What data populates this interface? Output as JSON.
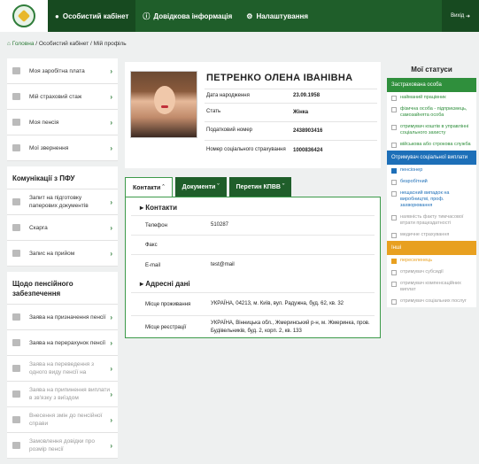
{
  "topbar": {
    "cabinet": "Особистий кабінет",
    "help": "Довідкова інформація",
    "settings": "Налаштування",
    "exit": "Вихід"
  },
  "breadcrumb": {
    "home": "Головна",
    "rest": " / Особистий кабінет / Мій профіль"
  },
  "sidebar": {
    "items": [
      "Моя заробітна плата",
      "Мій страховий стаж",
      "Моя пенсія",
      "Мої звернення"
    ],
    "comm_title": "Комунікації з ПФУ",
    "comm_items": [
      "Запит на підготовку паперових документів",
      "Скарга",
      "Запис на прийом"
    ],
    "pension_title": "Щодо пенсійного забезпечення",
    "pension_items": [
      "Заява на призначення пенсії",
      "Заява на перерахунок пенсії",
      "Заява на переведення з одного виду пенсії на",
      "Заява на припинення виплати в зв'язку з виїздом",
      "Внесення змін до пенсійної справи",
      "Замовлення довідки про розмір пенсії"
    ]
  },
  "profile": {
    "name": "ПЕТРЕНКО ОЛЕНА ІВАНІВНА",
    "birth_label": "Дата народження",
    "birth": "23.09.1958",
    "sex_label": "Стать",
    "sex": "Жінка",
    "tax_label": "Податковий номер",
    "tax": "2438903416",
    "ins_label": "Номер соціального страхування",
    "ins": "1000836424"
  },
  "tabs": [
    "Контакти",
    "Документи",
    "Перетин КПВВ"
  ],
  "contacts": {
    "title": "Контакти",
    "phone_label": "Телефон",
    "phone": "510287",
    "fax_label": "Факс",
    "fax": "",
    "email_label": "E-mail",
    "email": "test@mail"
  },
  "addresses": {
    "title": "Адресні дані",
    "live_label": "Місце проживання",
    "live": "УКРАЇНА, 04213, м. Київ, вул. Радужна, буд. 62, кв. 32",
    "reg_label": "Місце реєстрації",
    "reg": "УКРАЇНА, Вінницька обл., Жмеринський р-н, м. Жмеринка, пров. Будівельників, буд. 2, корп. 2, кв. 133"
  },
  "statuses": {
    "title": "Мої статуси",
    "insured": "Застрахована особа",
    "insured_items": [
      "найманий працівник",
      "фізична особа - підприємець, самозайнята особа",
      "отримувач коштів в управлінні соціального захисту",
      "військова або строкова служба"
    ],
    "social": "Отримувач соціальної виплати",
    "social_items": [
      "пенсіонер",
      "безробітний",
      "нещасний випадок на виробництві, проф. захворювання",
      "наявність факту тимчасової втрати працездатності",
      "медичне страхування"
    ],
    "other": "Інші",
    "other_items": [
      "переселенець",
      "отримувач субсидії",
      "отримувач компенсаційних виплат",
      "отримувач соціальних послуг"
    ]
  }
}
